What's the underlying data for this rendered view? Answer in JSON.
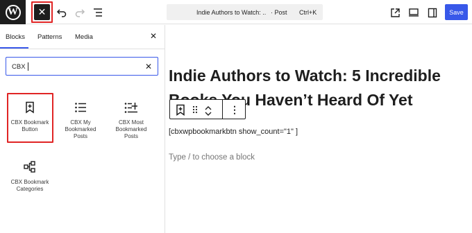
{
  "toolbar": {
    "logo_glyph": "W",
    "close_glyph": "✕",
    "doc_title": "Indie Authors to Watch: ...",
    "doc_type": "· Post",
    "shortcut": "Ctrl+K",
    "save_label": "Save",
    "icons": [
      "wordpress-logo",
      "close-icon",
      "undo-icon",
      "redo-icon",
      "document-overview-icon",
      "view-post-icon",
      "preview-desktop-icon",
      "settings-sidebar-icon"
    ],
    "accent_color": "#3858e9"
  },
  "sidebar": {
    "tabs": [
      {
        "label": "Blocks",
        "active": true
      },
      {
        "label": "Patterns",
        "active": false
      },
      {
        "label": "Media",
        "active": false
      }
    ],
    "close_glyph": "✕",
    "search": {
      "value": "CBX",
      "clear_glyph": "✕"
    },
    "blocks": [
      {
        "label": "CBX Bookmark Button",
        "icon": "bookmark-add-icon",
        "highlighted": true
      },
      {
        "label": "CBX My Bookmarked Posts",
        "icon": "list-icon",
        "highlighted": false
      },
      {
        "label": "CBX Most Bookmarked Posts",
        "icon": "list-add-icon",
        "highlighted": false
      },
      {
        "label": "CBX Bookmark Categories",
        "icon": "category-tree-icon",
        "highlighted": false
      }
    ]
  },
  "editor": {
    "post_title": "Indie Authors to Watch: 5 Incredible Books You Haven’t Heard Of Yet",
    "shortcode": "[cbxwpbookmarkbtn show_count=\"1\" ]",
    "placeholder": "Type / to choose a block",
    "block_toolbar": {
      "icons": [
        "bookmark-add-icon",
        "drag-handle-icon",
        "move-up-icon",
        "move-down-icon",
        "more-options-icon"
      ],
      "more_glyph": "⋮"
    }
  }
}
